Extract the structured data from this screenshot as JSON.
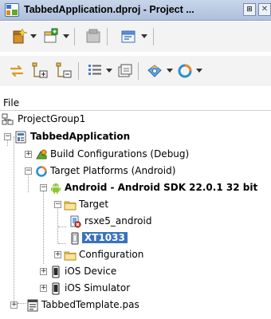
{
  "window": {
    "title": "TabbedApplication.dproj - Project ..."
  },
  "toolbar1": {
    "buttons": [
      "new-item-icon",
      "add-to-project-icon",
      "remove-icon",
      "options-icon"
    ]
  },
  "toolbar2": {
    "buttons": [
      "sync-icon",
      "expand-icon",
      "collapse-icon",
      "build-list-icon",
      "activate-icon",
      "device-icon",
      "target-icon"
    ]
  },
  "panel": {
    "header": "File"
  },
  "tree": {
    "project_group": "ProjectGroup1",
    "project": "TabbedApplication",
    "build_configs": "Build Configurations (Debug)",
    "target_platforms": "Target Platforms (Android)",
    "android_sdk": "Android - Android SDK 22.0.1 32 bit",
    "target": "Target",
    "rsxe5": "rsxe5_android",
    "xt1033": "XT1033",
    "configuration": "Configuration",
    "ios_device": "iOS Device",
    "ios_simulator": "iOS Simulator",
    "tabbed_template": "TabbedTemplate.pas"
  },
  "colors": {
    "selection": "#3a71c1",
    "title_bar": "#b9c9e2"
  }
}
